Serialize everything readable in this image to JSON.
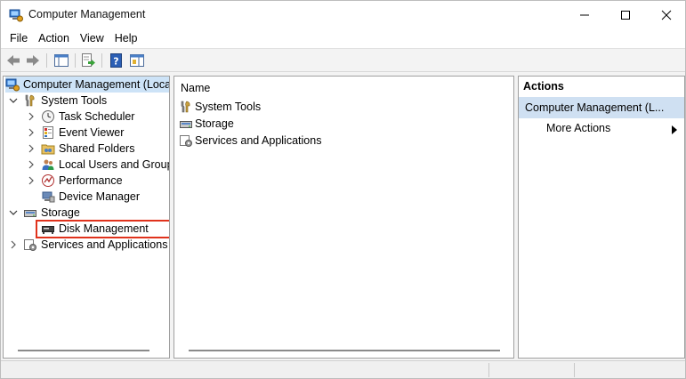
{
  "window": {
    "title": "Computer Management",
    "minimize_icon": "minimize-icon",
    "maximize_icon": "maximize-icon",
    "close_icon": "close-icon"
  },
  "menubar": {
    "items": [
      "File",
      "Action",
      "View",
      "Help"
    ]
  },
  "toolbar": {
    "buttons": [
      "back-arrow-icon",
      "forward-arrow-icon",
      "show-hide-console-tree-icon",
      "export-list-icon",
      "help-icon",
      "show-hide-action-pane-icon"
    ]
  },
  "tree": {
    "root": "Computer Management (Local",
    "items": [
      {
        "label": "System Tools",
        "expanded": true
      },
      {
        "label": "Task Scheduler"
      },
      {
        "label": "Event Viewer"
      },
      {
        "label": "Shared Folders"
      },
      {
        "label": "Local Users and Groups"
      },
      {
        "label": "Performance"
      },
      {
        "label": "Device Manager"
      },
      {
        "label": "Storage",
        "expanded": true
      },
      {
        "label": "Disk Management",
        "highlighted": true
      },
      {
        "label": "Services and Applications"
      }
    ]
  },
  "center": {
    "column_header": "Name",
    "rows": [
      "System Tools",
      "Storage",
      "Services and Applications"
    ]
  },
  "actions": {
    "title": "Actions",
    "selected": "Computer Management (L...",
    "more": "More Actions"
  },
  "colors": {
    "highlight_border": "#e0321c",
    "selected_bg": "#cfe0f2"
  }
}
